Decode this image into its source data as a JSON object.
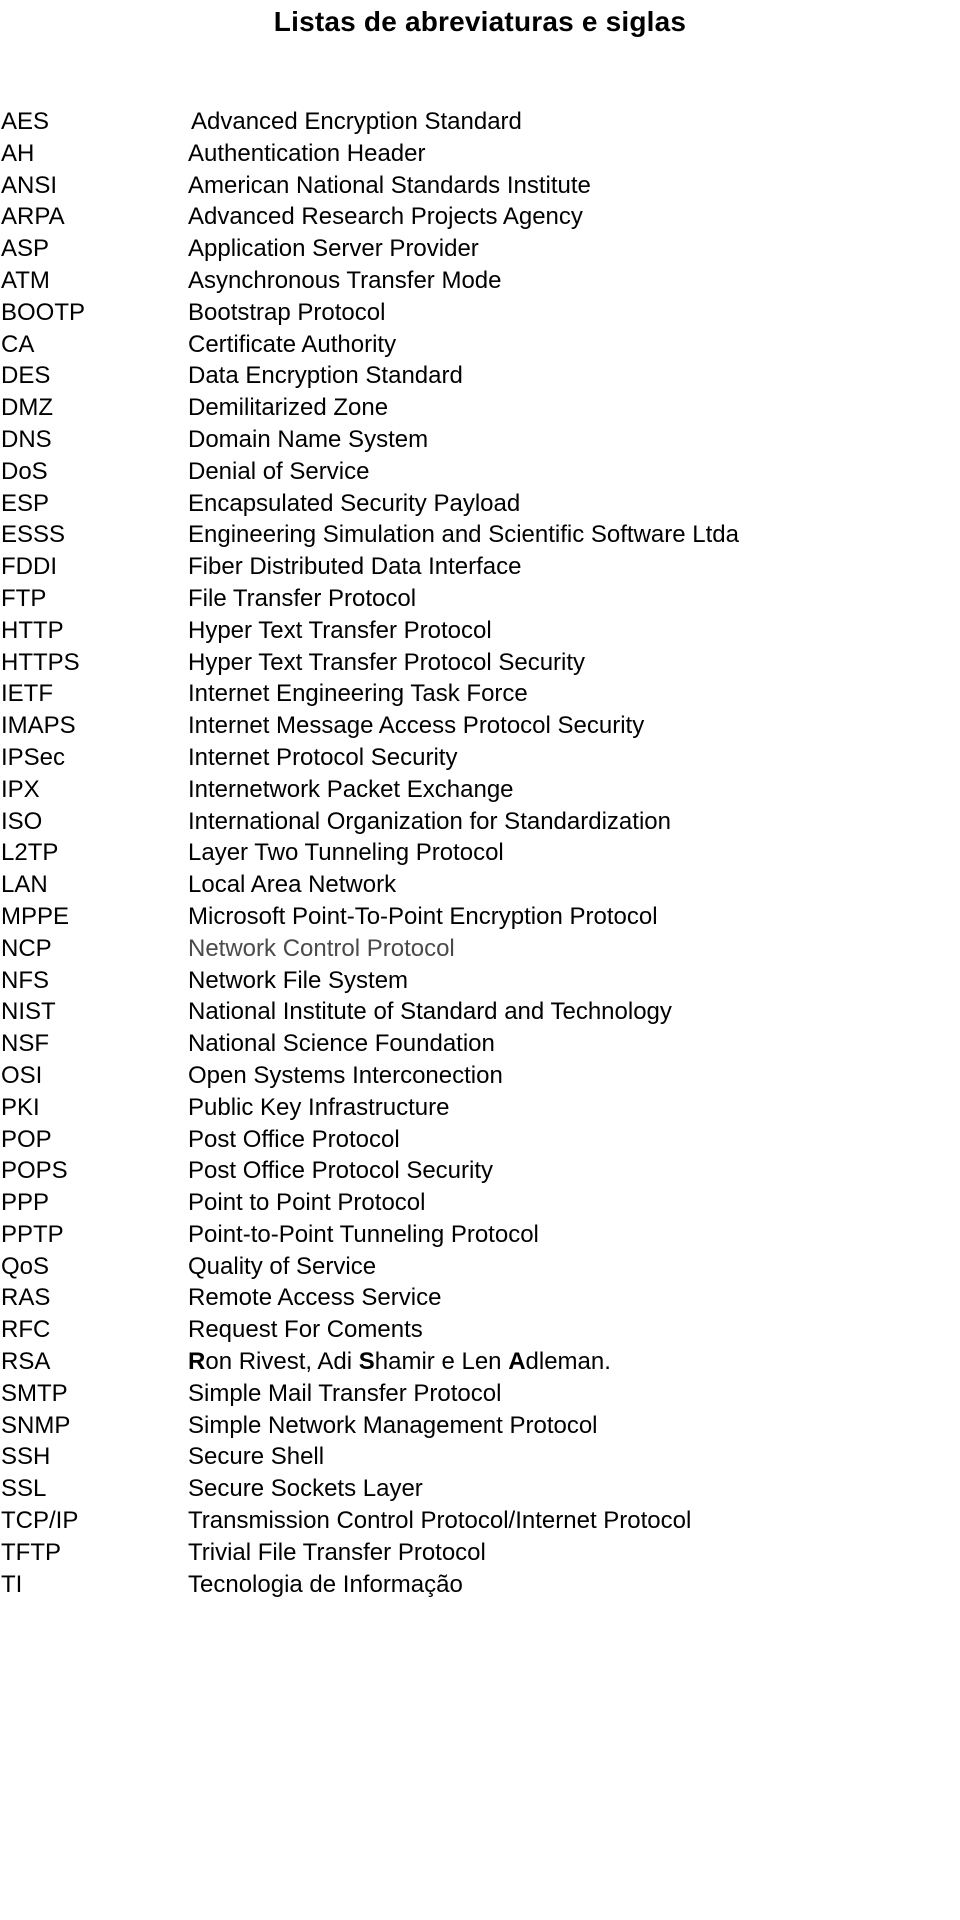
{
  "document": {
    "title": "Listas de abreviaturas e siglas"
  },
  "abbreviations": [
    {
      "term": "AES",
      "definition": "Advanced Encryption Standard"
    },
    {
      "term": "AH",
      "definition": "Authentication Header"
    },
    {
      "term": "ANSI",
      "definition": "American National Standards Institute"
    },
    {
      "term": "ARPA",
      "definition": "Advanced Research Projects Agency"
    },
    {
      "term": "ASP",
      "definition": "Application Server Provider"
    },
    {
      "term": "ATM",
      "definition": "Asynchronous Transfer Mode"
    },
    {
      "term": "BOOTP",
      "definition": "Bootstrap Protocol"
    },
    {
      "term": "CA",
      "definition": "Certificate Authority"
    },
    {
      "term": "DES",
      "definition": "Data Encryption Standard"
    },
    {
      "term": "DMZ",
      "definition": "Demilitarized Zone"
    },
    {
      "term": "DNS",
      "definition": "Domain Name System"
    },
    {
      "term": "DoS",
      "definition": "Denial of Service"
    },
    {
      "term": "ESP",
      "definition": "Encapsulated Security Payload"
    },
    {
      "term": "ESSS",
      "definition": "Engineering Simulation and Scientific Software Ltda"
    },
    {
      "term": "FDDI",
      "definition": "Fiber Distributed Data Interface"
    },
    {
      "term": "FTP",
      "definition": "File Transfer Protocol"
    },
    {
      "term": "HTTP",
      "definition": "Hyper Text Transfer Protocol"
    },
    {
      "term": "HTTPS",
      "definition": "Hyper Text Transfer Protocol Security"
    },
    {
      "term": "IETF",
      "definition": "Internet Engineering Task Force"
    },
    {
      "term": "IMAPS",
      "definition": "Internet Message Access Protocol Security"
    },
    {
      "term": "IPSec",
      "definition": "Internet Protocol Security"
    },
    {
      "term": "IPX",
      "definition": "Internetwork Packet Exchange"
    },
    {
      "term": "ISO",
      "definition": "International Organization for Standardization"
    },
    {
      "term": "L2TP",
      "definition": "Layer Two Tunneling Protocol"
    },
    {
      "term": "LAN",
      "definition": "Local Area Network"
    },
    {
      "term": "MPPE",
      "definition": "Microsoft Point-To-Point Encryption Protocol"
    },
    {
      "term": "NCP",
      "definition": "Network Control Protocol",
      "style": "faded"
    },
    {
      "term": "NFS",
      "definition": "Network File System"
    },
    {
      "term": "NIST",
      "definition": "National Institute of Standard and Technology"
    },
    {
      "term": "NSF",
      "definition": "National Science Foundation"
    },
    {
      "term": "OSI",
      "definition": "Open Systems Interconection"
    },
    {
      "term": "PKI",
      "definition": "Public Key Infrastructure"
    },
    {
      "term": "POP",
      "definition": "Post Office Protocol"
    },
    {
      "term": "POPS",
      "definition": "Post Office Protocol Security"
    },
    {
      "term": "PPP",
      "definition": "Point to Point Protocol"
    },
    {
      "term": "PPTP",
      "definition": "Point-to-Point Tunneling Protocol"
    },
    {
      "term": "QoS",
      "definition": "Quality of Service"
    },
    {
      "term": "RAS",
      "definition": "Remote Access Service"
    },
    {
      "term": "RFC",
      "definition": "Request For Coments"
    },
    {
      "term": "RSA",
      "definition": "Ron Rivest, Adi Shamir e Len Adleman.",
      "bold_letters": [
        "R",
        "S",
        "A"
      ]
    },
    {
      "term": "SMTP",
      "definition": "Simple Mail Transfer Protocol"
    },
    {
      "term": "SNMP",
      "definition": "Simple Network Management Protocol"
    },
    {
      "term": "SSH",
      "definition": "Secure Shell"
    },
    {
      "term": "SSL",
      "definition": "Secure Sockets Layer"
    },
    {
      "term": "TCP/IP",
      "definition": "Transmission Control Protocol/Internet Protocol"
    },
    {
      "term": "TFTP",
      "definition": "Trivial File Transfer Protocol"
    },
    {
      "term": "TI",
      "definition": "Tecnologia de Informação"
    }
  ]
}
